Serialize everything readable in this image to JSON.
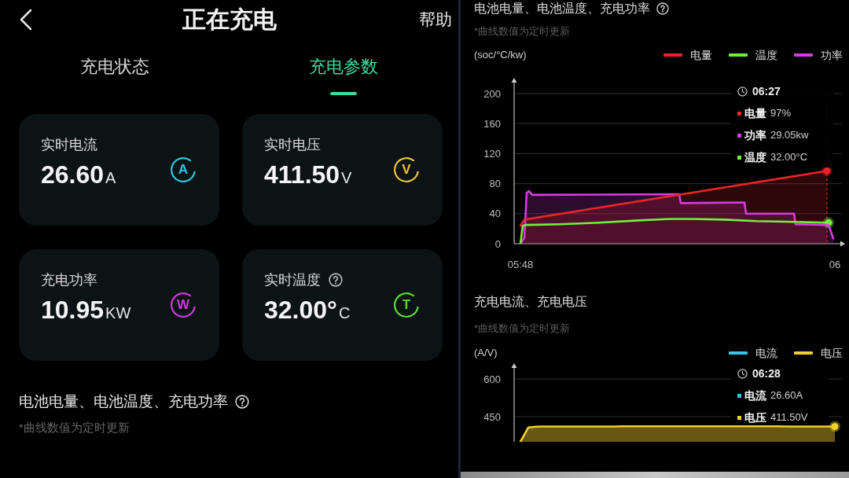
{
  "header": {
    "title": "正在充电",
    "help": "帮助"
  },
  "tabs": [
    {
      "label": "充电状态",
      "selected": false
    },
    {
      "label": "充电参数",
      "selected": true
    }
  ],
  "metrics": [
    {
      "label": "实时电流",
      "value": "26.60",
      "unit": "A",
      "symbol": "A",
      "color": "#2fc3df",
      "help": false
    },
    {
      "label": "实时电压",
      "value": "411.50",
      "unit": "V",
      "symbol": "V",
      "color": "#e6c233",
      "help": false
    },
    {
      "label": "充电功率",
      "value": "10.95",
      "unit": "KW",
      "symbol": "W",
      "color": "#c93bd9",
      "help": false
    },
    {
      "label": "实时温度",
      "value": "32.00°",
      "unit": "C",
      "symbol": "T",
      "color": "#5ad637",
      "help": true
    }
  ],
  "trend_section": {
    "title": "电池电量、电池温度、充电功率",
    "note": "*曲线数值为定时更新",
    "help": true
  },
  "charts": [
    {
      "title": "电池电量、电池温度、充电功率",
      "note": "*曲线数值为定时更新",
      "help": true,
      "chart_data": {
        "type": "line",
        "ylabel": "(soc/°C/kw)",
        "legend": "top-right",
        "grid": true,
        "xlim": [
          5.7867,
          6.4817
        ],
        "ylim": [
          0,
          200
        ],
        "xticks": [
          {
            "value": 5.8,
            "label": "05:48"
          },
          {
            "value": 6.4667,
            "label": "06"
          }
        ],
        "yticks": [
          0,
          40,
          80,
          120,
          160,
          200
        ],
        "series": [
          {
            "name": "电量",
            "color": "#e8242a",
            "type": "area",
            "x": [
              5.8,
              5.8083,
              6.45
            ],
            "values": [
              24,
              32,
              97
            ]
          },
          {
            "name": "温度",
            "color": "#74ee3e",
            "type": "line",
            "x": [
              5.8,
              5.805,
              5.8133,
              5.8833,
              5.9667,
              6.05,
              6.1167,
              6.1667,
              6.2333,
              6.3,
              6.3833,
              6.4533
            ],
            "values": [
              0,
              24,
              25,
              26,
              28,
              31,
              33,
              33,
              32,
              30,
              29,
              28
            ]
          },
          {
            "name": "功率",
            "color": "#d63ce2",
            "type": "area",
            "x": [
              5.8,
              5.8083,
              5.8133,
              5.8183,
              5.825,
              6.1367,
              6.14,
              6.275,
              6.2783,
              6.38,
              6.3833,
              6.4533,
              6.4633
            ],
            "values": [
              0,
              8,
              68,
              70,
              65,
              66,
              54,
              55,
              40,
              40,
              26,
              25,
              7
            ]
          },
          {
            "type": "scatter",
            "color": "#e8242a",
            "marker": "circle",
            "x": [
              6.45
            ],
            "values": [
              97
            ]
          },
          {
            "type": "scatter",
            "color": "#74ee3e",
            "marker": "circle",
            "x": [
              6.4533
            ],
            "values": [
              28
            ]
          }
        ],
        "ref_lines": [
          {
            "axis": "x",
            "value": 6.45,
            "color": "#e8242a",
            "line_style": "dashed"
          }
        ]
      },
      "tooltip": {
        "time": "06:27",
        "items": [
          {
            "label": "电量",
            "value": "97%",
            "color": "#e8242a"
          },
          {
            "label": "功率",
            "value": "29.05kw",
            "color": "#d63ce2"
          },
          {
            "label": "温度",
            "value": "32.00°C",
            "color": "#74ee3e"
          }
        ]
      }
    },
    {
      "title": "充电电流、充电电压",
      "note": "*曲线数值为定时更新",
      "help": false,
      "chart_data": {
        "type": "line",
        "ylabel": "(A/V)",
        "legend": "top-right",
        "grid": true,
        "ylim": [
          350,
          600
        ],
        "yticks": [
          450,
          600
        ],
        "categories": [
          null,
          null,
          null,
          null,
          null,
          null,
          null,
          null,
          null,
          null,
          null,
          null,
          null,
          null,
          null,
          null,
          null,
          null,
          null,
          null,
          null,
          null,
          null,
          null,
          null,
          null,
          null,
          null,
          null,
          null,
          null,
          null,
          null,
          null,
          null,
          null,
          null,
          null,
          null,
          null,
          null
        ],
        "series": [
          {
            "name": "电流",
            "color": "#2ccbe6",
            "type": "line",
            "values": [
              null,
              null,
              null,
              null,
              null,
              null,
              null,
              null,
              null,
              null,
              null,
              null,
              null,
              null,
              null,
              null,
              null,
              null,
              null,
              null,
              null,
              null,
              null,
              null,
              null,
              null,
              null,
              null,
              null,
              null,
              null,
              null,
              null,
              null,
              null,
              null,
              null,
              null,
              null,
              null,
              null
            ]
          },
          {
            "name": "电压",
            "color": "#f2d02a",
            "type": "area",
            "values": [
              350,
              407,
              410,
              411,
              411,
              411,
              411,
              411,
              411,
              411,
              411,
              411,
              411,
              412,
              412,
              412,
              412,
              412,
              412,
              412,
              412,
              412,
              412,
              412,
              412,
              412,
              412,
              412,
              412,
              412,
              412,
              412,
              412,
              412,
              411,
              411,
              411,
              411,
              411,
              411,
              411
            ]
          },
          {
            "type": "scatter",
            "color": "#f2d02a",
            "marker": "circle",
            "values": [
              null,
              null,
              null,
              null,
              null,
              null,
              null,
              null,
              null,
              null,
              null,
              null,
              null,
              null,
              null,
              null,
              null,
              null,
              null,
              null,
              null,
              null,
              null,
              null,
              null,
              null,
              null,
              null,
              null,
              null,
              null,
              null,
              null,
              null,
              null,
              null,
              null,
              null,
              null,
              null,
              411
            ]
          }
        ]
      },
      "tooltip": {
        "time": "06:28",
        "items": [
          {
            "label": "电流",
            "value": "26.60A",
            "color": "#2ccbe6"
          },
          {
            "label": "电压",
            "value": "411.50V",
            "color": "#f2d02a"
          }
        ]
      }
    }
  ]
}
